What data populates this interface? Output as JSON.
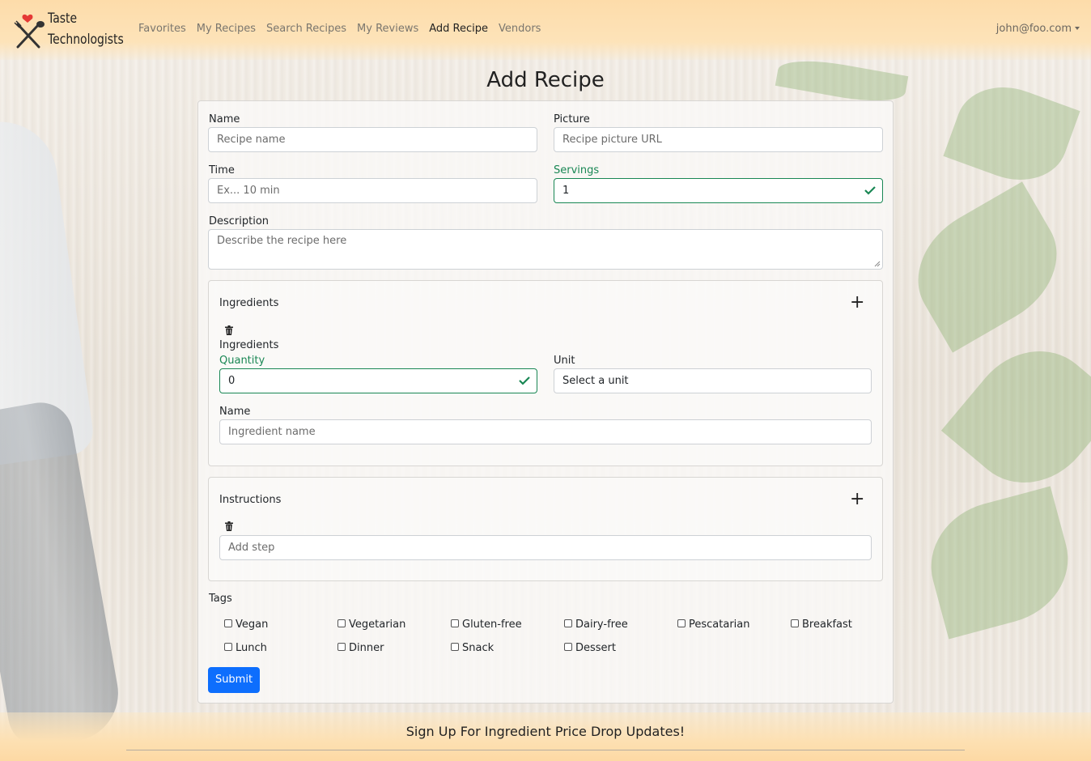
{
  "brand": {
    "logo_icon": "fork-spoon-heart-icon",
    "line1": "Taste",
    "line2": "Technologists"
  },
  "nav": {
    "items": [
      {
        "label": "Favorites",
        "active": false
      },
      {
        "label": "My Recipes",
        "active": false
      },
      {
        "label": "Search Recipes",
        "active": false
      },
      {
        "label": "My Reviews",
        "active": false
      },
      {
        "label": "Add Recipe",
        "active": true
      },
      {
        "label": "Vendors",
        "active": false
      }
    ],
    "user": "john@foo.com"
  },
  "page": {
    "title": "Add Recipe"
  },
  "form": {
    "name": {
      "label": "Name",
      "placeholder": "Recipe name",
      "value": ""
    },
    "picture": {
      "label": "Picture",
      "placeholder": "Recipe picture URL",
      "value": ""
    },
    "time": {
      "label": "Time",
      "placeholder": "Ex... 10 min",
      "value": ""
    },
    "servings": {
      "label": "Servings",
      "value": "1",
      "valid": true
    },
    "description": {
      "label": "Description",
      "placeholder": "Describe the recipe here",
      "value": ""
    },
    "ingredients": {
      "heading": "Ingredients",
      "add_icon": "plus-icon",
      "item": {
        "delete_icon": "trash-icon",
        "heading": "Ingredients",
        "quantity": {
          "label": "Quantity",
          "value": "0",
          "valid": true
        },
        "unit": {
          "label": "Unit",
          "value": "Select a unit"
        },
        "name": {
          "label": "Name",
          "placeholder": "Ingredient name",
          "value": ""
        }
      }
    },
    "instructions": {
      "heading": "Instructions",
      "add_icon": "plus-icon",
      "item": {
        "delete_icon": "trash-icon",
        "placeholder": "Add step",
        "value": ""
      }
    },
    "tags": {
      "label": "Tags",
      "options": [
        {
          "label": "Vegan",
          "checked": false
        },
        {
          "label": "Vegetarian",
          "checked": false
        },
        {
          "label": "Gluten-free",
          "checked": false
        },
        {
          "label": "Dairy-free",
          "checked": false
        },
        {
          "label": "Pescatarian",
          "checked": false
        },
        {
          "label": "Breakfast",
          "checked": false
        },
        {
          "label": "Lunch",
          "checked": false
        },
        {
          "label": "Dinner",
          "checked": false
        },
        {
          "label": "Snack",
          "checked": false
        },
        {
          "label": "Dessert",
          "checked": false
        }
      ]
    },
    "submit_label": "Submit"
  },
  "footer": {
    "text": "Sign Up For Ingredient Price Drop Updates!"
  },
  "colors": {
    "primary": "#0d6efd",
    "valid": "#198754",
    "navbar": "#fde3b9"
  }
}
